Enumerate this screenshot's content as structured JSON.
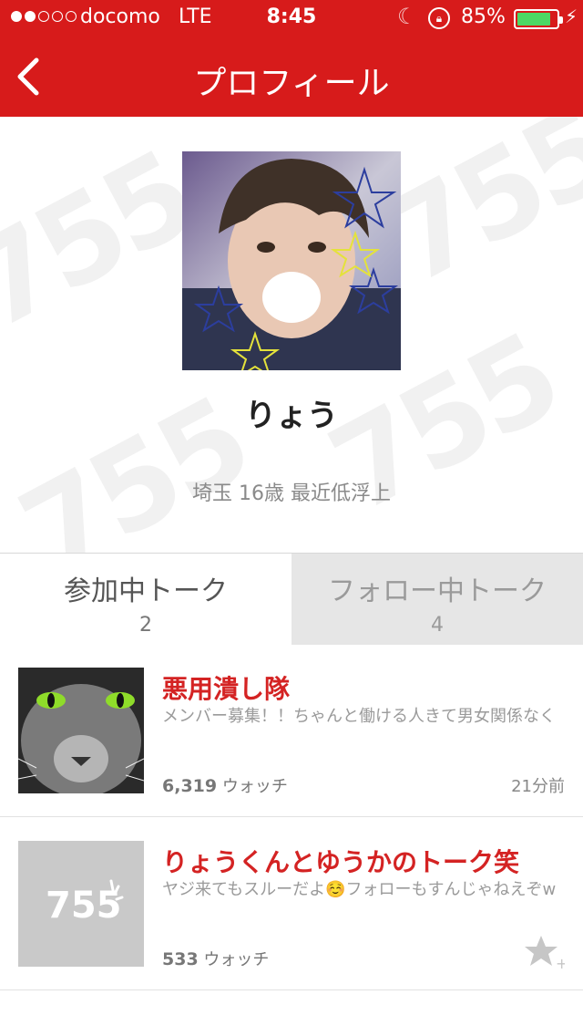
{
  "status": {
    "carrier": "docomo",
    "network": "LTE",
    "time": "8:45",
    "battery": "85%",
    "battery_level": 0.85
  },
  "nav": {
    "title": "プロフィール"
  },
  "profile": {
    "name": "りょう",
    "bio": "埼玉 16歳 最近低浮上"
  },
  "tabs": [
    {
      "label": "参加中トーク",
      "count": "2"
    },
    {
      "label": "フォロー中トーク",
      "count": "4"
    }
  ],
  "talks": [
    {
      "title": "悪用潰し隊",
      "description": "メンバー募集！！ちゃんと働ける人きて男女関係なく",
      "watch_count": "6,319",
      "watch_label": "ウォッチ",
      "time": "21分前"
    },
    {
      "title": "りょうくんとゆうかのトーク笑",
      "description": "ヤジ来てもスルーだよ☺️フォローもすんじゃねえぞw",
      "watch_count": "533",
      "watch_label": "ウォッチ",
      "placeholder_logo": "755"
    }
  ],
  "colors": {
    "brand": "#d71b1b",
    "title_red": "#d42323",
    "battery_green": "#4cd964"
  }
}
